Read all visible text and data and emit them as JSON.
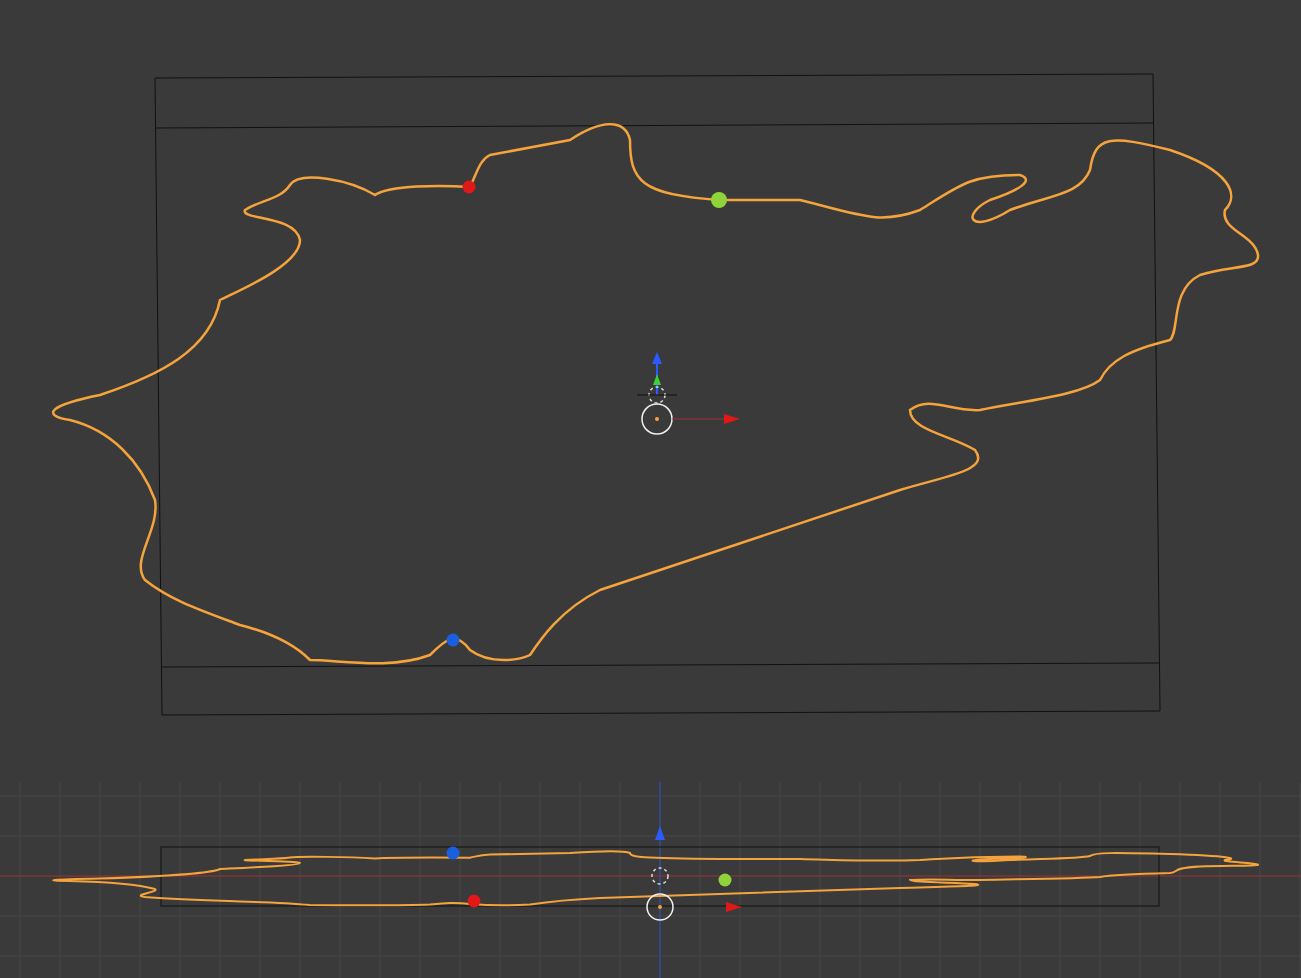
{
  "views": [
    {
      "kind": "top",
      "markers": [
        {
          "color": "#e01818"
        },
        {
          "color": "#8fd43a"
        },
        {
          "color": "#1a5fe0"
        }
      ]
    },
    {
      "kind": "side",
      "markers": [
        {
          "color": "#1a5fe0"
        },
        {
          "color": "#e01818"
        },
        {
          "color": "#8fd43a"
        }
      ]
    }
  ]
}
